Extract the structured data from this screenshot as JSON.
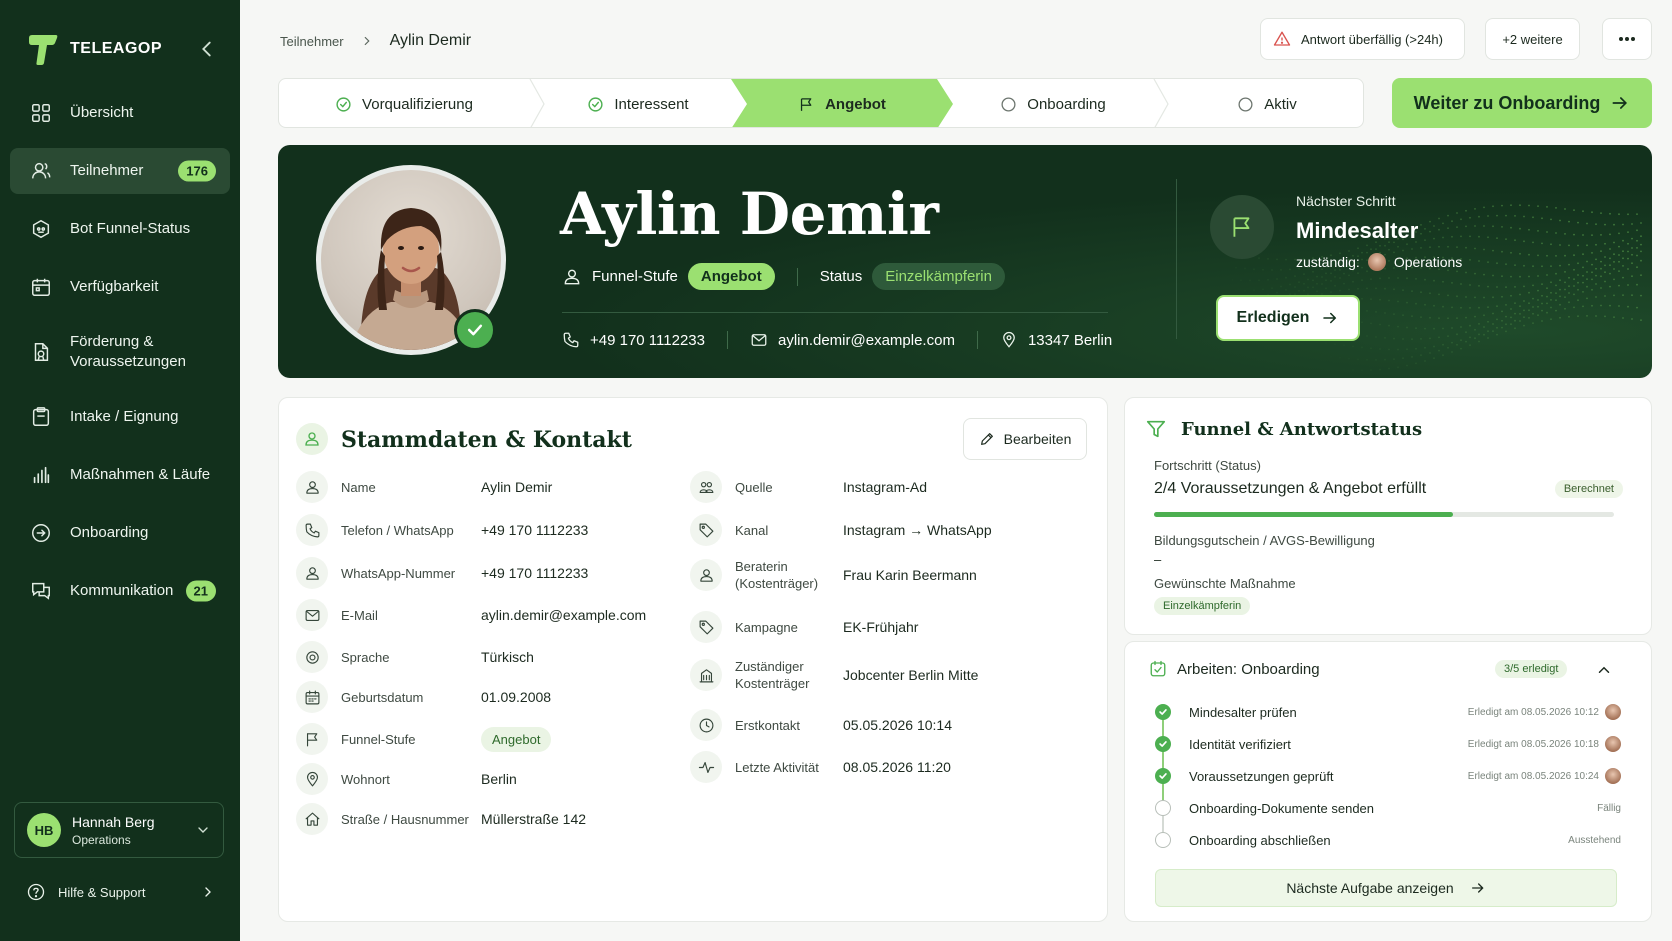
{
  "app": {
    "brand": "TELEAGOP"
  },
  "sidebar": {
    "items": [
      {
        "label": "Übersicht",
        "icon": "grid-icon"
      },
      {
        "label": "Teilnehmer",
        "icon": "users-icon",
        "badge": "176",
        "active": true
      },
      {
        "label": "Bot Funnel-Status",
        "icon": "bot-icon"
      },
      {
        "label": "Verfügbarkeit",
        "icon": "calendar-icon"
      },
      {
        "label": "Förderung & Voraussetzungen",
        "icon": "document-icon"
      },
      {
        "label": "Intake / Eignung",
        "icon": "clipboard-icon"
      },
      {
        "label": "Maßnahmen & Läufe",
        "icon": "bar-chart-icon"
      },
      {
        "label": "Onboarding",
        "icon": "arrow-circle-icon"
      },
      {
        "label": "Kommunikation",
        "icon": "chat-icon",
        "badge": "21"
      }
    ],
    "user": {
      "initials": "HB",
      "name": "Hannah Berg",
      "role": "Operations"
    },
    "help": "Hilfe & Support"
  },
  "header": {
    "breadcrumb_parent": "Teilnehmer",
    "breadcrumb_current": "Aylin Demir",
    "alert": "Antwort überfällig (>24h)",
    "more": "+2 weitere"
  },
  "stepper": {
    "steps": [
      {
        "label": "Vorqualifizierung",
        "state": "done"
      },
      {
        "label": "Interessent",
        "state": "done"
      },
      {
        "label": "Angebot",
        "state": "active"
      },
      {
        "label": "Onboarding",
        "state": "todo"
      },
      {
        "label": "Aktiv",
        "state": "todo"
      }
    ],
    "cta": "Weiter zu Onboarding"
  },
  "hero": {
    "name": "Aylin Demir",
    "funnel_label": "Funnel-Stufe",
    "funnel_value": "Angebot",
    "status_label": "Status",
    "status_value": "Einzelkämpferin",
    "phone": "+49 170 1112233",
    "email": "aylin.demir@example.com",
    "location": "13347 Berlin",
    "next_step_label": "Nächster Schritt",
    "next_step_title": "Mindesalter",
    "owner_label": "zuständig:",
    "owner_value": "Operations",
    "done_button": "Erledigen"
  },
  "stamm": {
    "title": "Stammdaten & Kontakt",
    "edit": "Bearbeiten",
    "left": [
      {
        "label": "Name",
        "value": "Aylin Demir",
        "icon": "user-icon"
      },
      {
        "label": "Telefon / WhatsApp",
        "value": "+49 170 1112233",
        "icon": "phone-icon"
      },
      {
        "label": "WhatsApp-Nummer",
        "value": "+49 170 1112233",
        "icon": "user-icon"
      },
      {
        "label": "E-Mail",
        "value": "aylin.demir@example.com",
        "icon": "mail-icon"
      },
      {
        "label": "Sprache",
        "value": "Türkisch",
        "icon": "globe-icon"
      },
      {
        "label": "Geburtsdatum",
        "value": "01.09.2008",
        "icon": "calendar-icon"
      },
      {
        "label": "Funnel-Stufe",
        "value": "Angebot",
        "icon": "flag-icon"
      },
      {
        "label": "Wohnort",
        "value": "Berlin",
        "icon": "pin-icon"
      },
      {
        "label": "Straße / Hausnummer",
        "value": "Müllerstraße 142",
        "icon": "home-icon"
      }
    ],
    "right": [
      {
        "label": "Quelle",
        "value": "Instagram-Ad",
        "icon": "users-icon"
      },
      {
        "label": "Kanal",
        "value": "Instagram → WhatsApp",
        "icon": "tag-icon"
      },
      {
        "label": "Beraterin (Kostenträger)",
        "value": "Frau Karin Beermann",
        "icon": "user-icon"
      },
      {
        "label": "Kampagne",
        "value": "EK-Frühjahr",
        "icon": "tag-icon"
      },
      {
        "label": "Zuständiger Kostenträger",
        "value": "Jobcenter Berlin Mitte",
        "icon": "building-icon"
      },
      {
        "label": "Erstkontakt",
        "value": "05.05.2026 10:14",
        "icon": "clock-icon"
      },
      {
        "label": "Letzte Aktivität",
        "value": "08.05.2026 11:20",
        "icon": "activity-icon"
      }
    ]
  },
  "funnel": {
    "title": "Funnel & Antwortstatus",
    "progress_label": "Fortschritt (Status)",
    "progress_text": "2/4 Voraussetzungen & Angebot erfüllt",
    "progress_tag": "Berechnet",
    "progress_fraction": 0.65,
    "voucher_label": "Bildungsgutschein / AVGS-Bewilligung",
    "voucher_value": "–",
    "measure_label": "Gewünschte Maßnahme",
    "measure_value": "Einzelkämpferin"
  },
  "tasks": {
    "title": "Arbeiten: Onboarding",
    "count": "3/5 erledigt",
    "items": [
      {
        "name": "Mindesalter prüfen",
        "meta": "Erledigt am 08.05.2026 10:12",
        "done": true
      },
      {
        "name": "Identität verifiziert",
        "meta": "Erledigt am 08.05.2026 10:18",
        "done": true
      },
      {
        "name": "Voraussetzungen geprüft",
        "meta": "Erledigt am 08.05.2026 10:24",
        "done": true
      },
      {
        "name": "Onboarding-Dokumente senden",
        "meta": "Fällig",
        "done": false
      },
      {
        "name": "Onboarding abschließen",
        "meta": "Ausstehend",
        "done": false
      }
    ],
    "next_button": "Nächste Aufgabe anzeigen"
  },
  "colors": {
    "sidebar": "#12301c",
    "accent": "#9be071",
    "success": "#4caf50",
    "alert": "#d9534f"
  }
}
